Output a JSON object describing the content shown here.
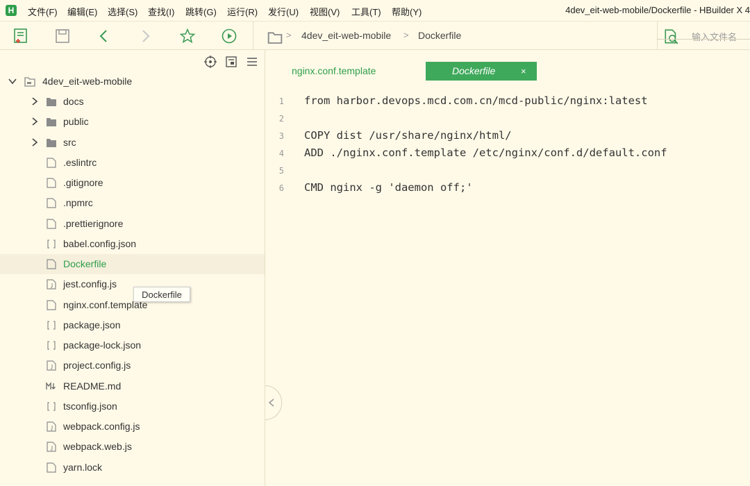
{
  "app": {
    "logo_letter": "H"
  },
  "menu": [
    "文件(F)",
    "编辑(E)",
    "选择(S)",
    "查找(I)",
    "跳转(G)",
    "运行(R)",
    "发行(U)",
    "视图(V)",
    "工具(T)",
    "帮助(Y)"
  ],
  "window_title": "4dev_eit-web-mobile/Dockerfile - HBuilder X 4",
  "toolbar": {
    "icons": [
      "new-file-icon",
      "save-icon",
      "back-icon",
      "forward-icon",
      "favorite-star-icon",
      "run-icon"
    ],
    "breadcrumb": [
      "4dev_eit-web-mobile",
      "Dockerfile"
    ],
    "search_placeholder": "输入文件名"
  },
  "sidebar": {
    "tools": [
      "locate-icon",
      "collapse-all-icon",
      "menu-icon"
    ],
    "root": "4dev_eit-web-mobile",
    "items": [
      {
        "label": "docs",
        "type": "folder"
      },
      {
        "label": "public",
        "type": "folder"
      },
      {
        "label": "src",
        "type": "folder"
      },
      {
        "label": ".eslintrc",
        "type": "file"
      },
      {
        "label": ".gitignore",
        "type": "file"
      },
      {
        "label": ".npmrc",
        "type": "file"
      },
      {
        "label": ".prettierignore",
        "type": "file"
      },
      {
        "label": "babel.config.json",
        "type": "json"
      },
      {
        "label": "Dockerfile",
        "type": "file",
        "selected": true
      },
      {
        "label": "jest.config.js",
        "type": "js"
      },
      {
        "label": "nginx.conf.template",
        "type": "file"
      },
      {
        "label": "package.json",
        "type": "json"
      },
      {
        "label": "package-lock.json",
        "type": "json"
      },
      {
        "label": "project.config.js",
        "type": "js"
      },
      {
        "label": "README.md",
        "type": "md"
      },
      {
        "label": "tsconfig.json",
        "type": "json"
      },
      {
        "label": "webpack.config.js",
        "type": "js"
      },
      {
        "label": "webpack.web.js",
        "type": "js"
      },
      {
        "label": "yarn.lock",
        "type": "file"
      }
    ],
    "tooltip": "Dockerfile"
  },
  "tabs": [
    {
      "label": "nginx.conf.template",
      "active": false
    },
    {
      "label": "Dockerfile",
      "active": true,
      "close": "×"
    }
  ],
  "editor": {
    "lines": [
      {
        "n": "1",
        "code": "from harbor.devops.mcd.com.cn/mcd-public/nginx:latest"
      },
      {
        "n": "2",
        "code": ""
      },
      {
        "n": "3",
        "code": "COPY dist /usr/share/nginx/html/"
      },
      {
        "n": "4",
        "code": "ADD ./nginx.conf.template /etc/nginx/conf.d/default.conf"
      },
      {
        "n": "5",
        "code": ""
      },
      {
        "n": "6",
        "code": "CMD nginx -g 'daemon off;'"
      }
    ]
  },
  "colors": {
    "accent": "#2e9e4a",
    "tab_active": "#3fa95b",
    "background": "#fffae8"
  }
}
